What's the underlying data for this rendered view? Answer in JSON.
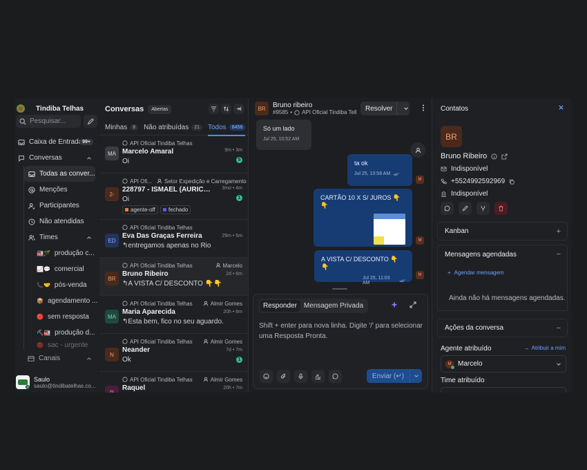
{
  "sidebar": {
    "brand": "Tindiba Telhas",
    "search_placeholder": "Pesquisar...",
    "inbox_label": "Caixa de Entrada",
    "inbox_badge": "99+",
    "conversations_label": "Conversas",
    "sub_items": [
      {
        "label": "Todas as conver..."
      },
      {
        "label": "Menções"
      },
      {
        "label": "Participantes"
      },
      {
        "label": "Não atendidas"
      }
    ],
    "teams_label": "Times",
    "teams": [
      {
        "emoji": "🏭🪄",
        "label": "produção c..."
      },
      {
        "emoji": "📈💬",
        "label": "comercial"
      },
      {
        "emoji": "📞🤝",
        "label": "pós-venda"
      },
      {
        "emoji": "📦",
        "label": "agendamento ..."
      },
      {
        "emoji": "🔴",
        "label": "sem resposta"
      },
      {
        "emoji": "⛏🏭",
        "label": "produção d..."
      },
      {
        "emoji": "🔴",
        "label": "sac - urgente"
      }
    ],
    "channels_label": "Canais",
    "user": {
      "name": "Saulo",
      "email": "saulo@tindibatelhas.co..."
    }
  },
  "convlist": {
    "title": "Conversas",
    "status": "Abertas",
    "tabs": [
      {
        "label": "Minhas",
        "count": "8"
      },
      {
        "label": "Não atribuídas",
        "count": "21"
      },
      {
        "label": "Todos",
        "count": "8458"
      }
    ],
    "items": [
      {
        "initials": "MA",
        "inbox": "API Oficial Tindiba Telhas",
        "assignee": "",
        "name": "Marcelo Amaral",
        "time": "9m • 3m",
        "message": "Oi",
        "unread": "5"
      },
      {
        "initials": "2-",
        "inbox": "API Ofi...",
        "assignee": "Setor Expedição e Carregamento",
        "name": "228797 - ISMAEL (AURICELI...",
        "time": "3mo • 4m",
        "message": "Oi",
        "unread": "1",
        "labels": [
          {
            "text": "agente-off",
            "color": "#e8843c"
          },
          {
            "text": "fechado",
            "color": "#5b5bf0"
          }
        ]
      },
      {
        "initials": "ED",
        "inbox": "API Oficial Tindiba Telhas",
        "assignee": "",
        "name": "Eva Das Graças Ferreira",
        "time": "29m • 5m",
        "message": "↰entregamos apenas no Rio",
        "unread": ""
      },
      {
        "initials": "BR",
        "inbox": "API Oficial Tindiba Telhas",
        "assignee": "Marcelo",
        "name": "Bruno Ribeiro",
        "time": "2d • 6m",
        "message": "↰A VISTA C/ DESCONTO 👇👇",
        "unread": ""
      },
      {
        "initials": "MA",
        "inbox": "API Oficial Tindiba Telhas",
        "assignee": "Almir Gomes",
        "name": "Maria Aparecida",
        "time": "20h • 6m",
        "message": "↰Esta bem, fico no seu aguardo.",
        "unread": ""
      },
      {
        "initials": "N",
        "inbox": "API Oficial Tindiba Telhas",
        "assignee": "Almir Gomes",
        "name": "Neander",
        "time": "7d • 7m",
        "message": "Ok",
        "unread": "1"
      },
      {
        "initials": "R",
        "inbox": "API Oficial Tindiba Telhas",
        "assignee": "Almir Gomes",
        "name": "Raquel",
        "time": "20h • 7m",
        "message": "",
        "unread": ""
      }
    ]
  },
  "chat": {
    "avatar": "BR",
    "name": "Bruno ribeiro",
    "id": "#9585",
    "inbox": "API Oficial Tindiba Tell",
    "resolve_label": "Resolver",
    "messages": [
      {
        "text": "Só um lado",
        "time": "Jul 25, 10:52 AM"
      },
      {
        "text": "ta ok",
        "time": "Jul 25, 10:58 AM"
      },
      {
        "text": "CARTÃO 10 X S/ JUROS 👇👇"
      },
      {
        "text": "A VISTA C/ DESCONTO 👇👇",
        "time": "Jul 25, 11:03 AM"
      }
    ],
    "sender_avatar": "M",
    "reply_tab": "Responder",
    "private_tab": "Mensagem Privada",
    "placeholder": "Shift + enter para nova linha. Digite '/' para selecionar uma Resposta Pronta.",
    "send_label": "Enviar (↵)"
  },
  "contact": {
    "header": "Contatos",
    "avatar": "BR",
    "name": "Bruno Ribeiro",
    "email": "Indisponível",
    "phone": "+5524992592969",
    "company": "Indisponível",
    "kanban": "Kanban",
    "scheduled": "Mensagens agendadas",
    "schedule_link": "Agendar mensagem",
    "scheduled_empty": "Ainda não há mensagens agendadas.",
    "actions_title": "Ações da conversa",
    "agent_label": "Agente atribuído",
    "assign_me": "Atribuir a mim",
    "agent_value": "Marcelo",
    "agent_avatar": "M",
    "team_label": "Time atribuído"
  },
  "colors": {
    "accent": "#4b8dff",
    "outgoing_bubble": "#173c73",
    "unread": "#33c08a"
  }
}
